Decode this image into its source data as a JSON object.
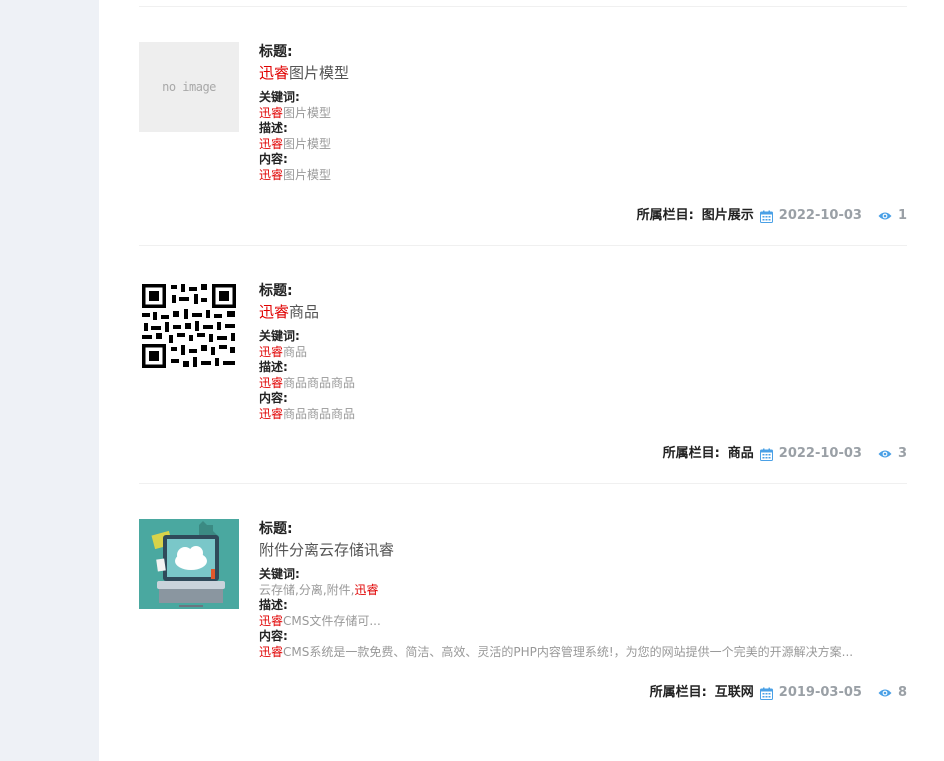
{
  "labels": {
    "title": "标题:",
    "keywords": "关键词:",
    "description": "描述:",
    "content": "内容:",
    "category": "所属栏目:"
  },
  "colors": {
    "highlight": "#e00000",
    "icon": "#4aa0e6",
    "muted": "#999999"
  },
  "items": [
    {
      "thumb_text": "no image",
      "title_hl": "迅睿",
      "title_rest": "图片模型",
      "keywords_hl": "迅睿",
      "keywords_rest": "图片模型",
      "desc_hl": "迅睿",
      "desc_rest": "图片模型",
      "content_hl": "迅睿",
      "content_rest": "图片模型",
      "category": "图片展示",
      "date": "2022-10-03",
      "views": "1"
    },
    {
      "thumb_icon": "qr-code-icon",
      "title_hl": "迅睿",
      "title_rest": "商品",
      "keywords_hl": "迅睿",
      "keywords_rest": "商品",
      "desc_hl": "迅睿",
      "desc_rest": "商品商品商品",
      "content_hl": "迅睿",
      "content_rest": "商品商品商品",
      "category": "商品",
      "date": "2022-10-03",
      "views": "3"
    },
    {
      "thumb_icon": "cloud-laptop-illustration",
      "title_text": "附件分离云存储讯睿",
      "keywords_plain": "云存储,分离,附件,",
      "keywords_hl_end": "迅睿",
      "desc_hl": "迅睿",
      "desc_rest": "CMS文件存储可...",
      "content_hl": "迅睿",
      "content_rest": "CMS系统是一款免费、简洁、高效、灵活的PHP内容管理系统!，为您的网站提供一个完美的开源解决方案...",
      "category": "互联网",
      "date": "2019-03-05",
      "views": "8"
    }
  ]
}
